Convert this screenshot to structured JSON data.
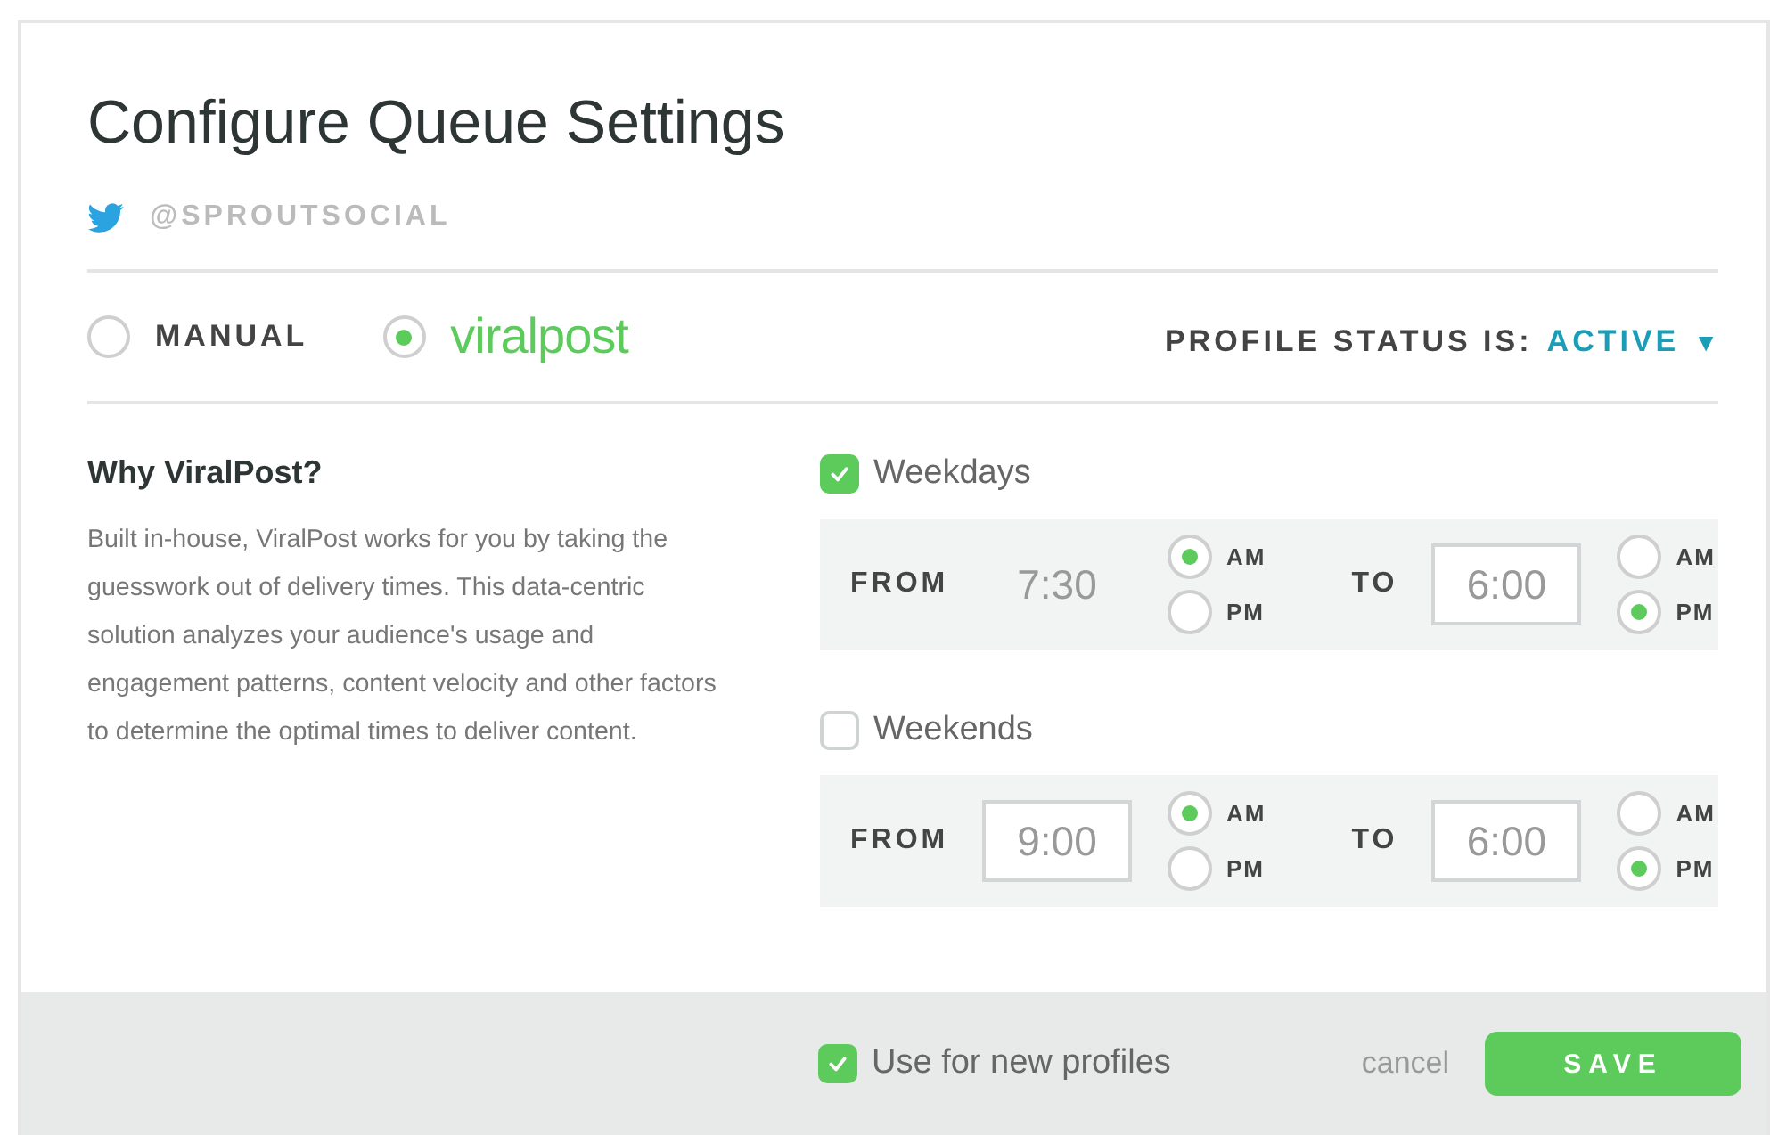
{
  "title": "Configure Queue Settings",
  "account": {
    "handle": "@SPROUTSOCIAL"
  },
  "modes": [
    {
      "kind": "text",
      "label": "MANUAL",
      "selected": false
    },
    {
      "kind": "logo",
      "label": "viralpost",
      "selected": true
    }
  ],
  "status": {
    "label": "PROFILE STATUS IS:",
    "value": "ACTIVE",
    "caret": "▼"
  },
  "info": {
    "heading": "Why ViralPost?",
    "body": "Built in-house, ViralPost works for you by taking the guesswork out of delivery times. This data-centric solution analyzes your audience's usage and engagement patterns, content velocity and other factors to determine the optimal times to deliver content."
  },
  "schedules": [
    {
      "label": "Weekdays",
      "checked": true,
      "ranges": [
        {
          "label": "FROM",
          "time": "7:30",
          "framed": false,
          "meridiems": [
            {
              "label": "AM",
              "selected": true
            },
            {
              "label": "PM",
              "selected": false
            }
          ]
        },
        {
          "label": "TO",
          "time": "6:00",
          "framed": true,
          "meridiems": [
            {
              "label": "AM",
              "selected": false
            },
            {
              "label": "PM",
              "selected": true
            }
          ]
        }
      ]
    },
    {
      "label": "Weekends",
      "checked": false,
      "ranges": [
        {
          "label": "FROM",
          "time": "9:00",
          "framed": true,
          "meridiems": [
            {
              "label": "AM",
              "selected": true
            },
            {
              "label": "PM",
              "selected": false
            }
          ]
        },
        {
          "label": "TO",
          "time": "6:00",
          "framed": true,
          "meridiems": [
            {
              "label": "AM",
              "selected": false
            },
            {
              "label": "PM",
              "selected": true
            }
          ]
        }
      ]
    }
  ],
  "footer": {
    "option": {
      "label": "Use for new profiles",
      "checked": true
    },
    "cancel": "cancel",
    "save": "SAVE"
  }
}
